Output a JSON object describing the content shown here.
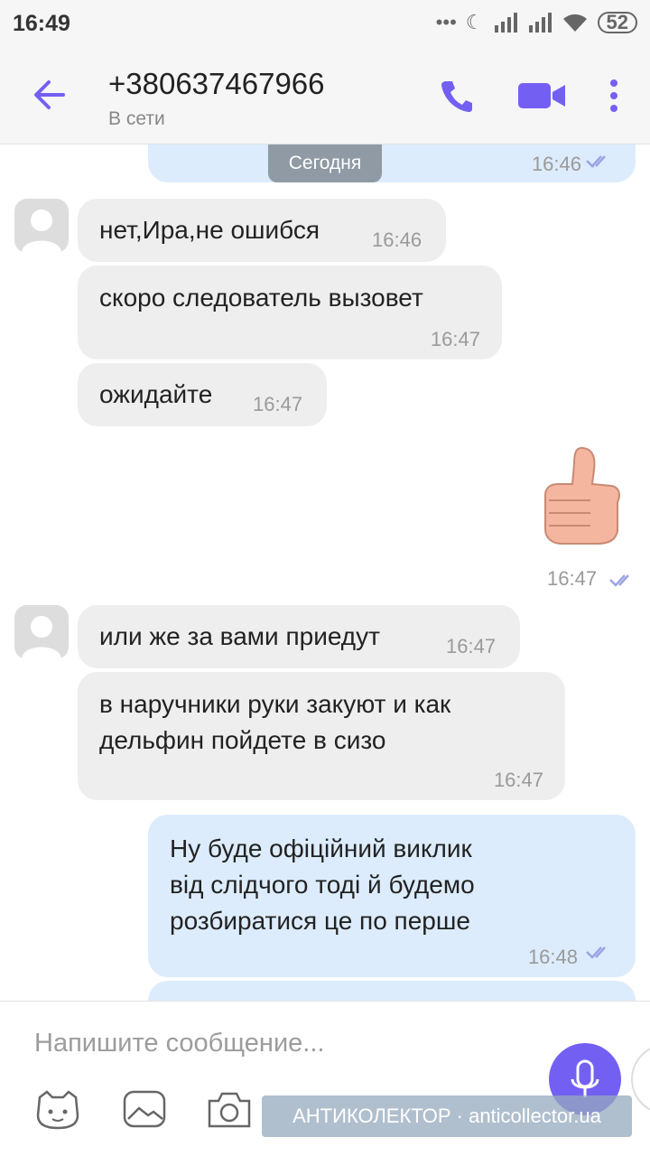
{
  "status_bar": {
    "time": "16:49",
    "battery": "52"
  },
  "header": {
    "title": "+380637467966",
    "subtitle": "В сети"
  },
  "chat": {
    "date_chip": "Сегодня",
    "top_partial_time": "16:46",
    "messages": [
      {
        "direction": "in",
        "text": "нет,Ира,не ошибся",
        "time": "16:46"
      },
      {
        "direction": "in",
        "text": "скоро следователь вызовет",
        "time": "16:47"
      },
      {
        "direction": "in",
        "text": "ожидайте",
        "time": "16:47"
      },
      {
        "direction": "out",
        "sticker": "thumbs-up",
        "time": "16:47"
      },
      {
        "direction": "in",
        "text": "или же за вами приедут",
        "time": "16:47"
      },
      {
        "direction": "in",
        "lines": [
          "в наручники руки закуют и как",
          "дельфин пойдете в сизо"
        ],
        "time": "16:47"
      },
      {
        "direction": "out",
        "lines": [
          "Ну буде офіційний виклик",
          "від слідчого тоді й будемо",
          "розбиратися це по перше"
        ],
        "time": "16:48"
      }
    ]
  },
  "composer": {
    "placeholder": "Напишите сообщение..."
  },
  "watermark": "АНТИКОЛЕКТОР · anticollector.ua",
  "colors": {
    "accent": "#7360f2",
    "incoming": "#eeeeee",
    "outgoing": "#dcecfc"
  },
  "icons": [
    "back-arrow-icon",
    "phone-icon",
    "video-camera-icon",
    "more-vert-icon",
    "double-check-icon",
    "sticker-icon",
    "gallery-icon",
    "camera-icon",
    "gif-icon",
    "doodle-icon",
    "more-horiz-icon",
    "mic-icon"
  ]
}
